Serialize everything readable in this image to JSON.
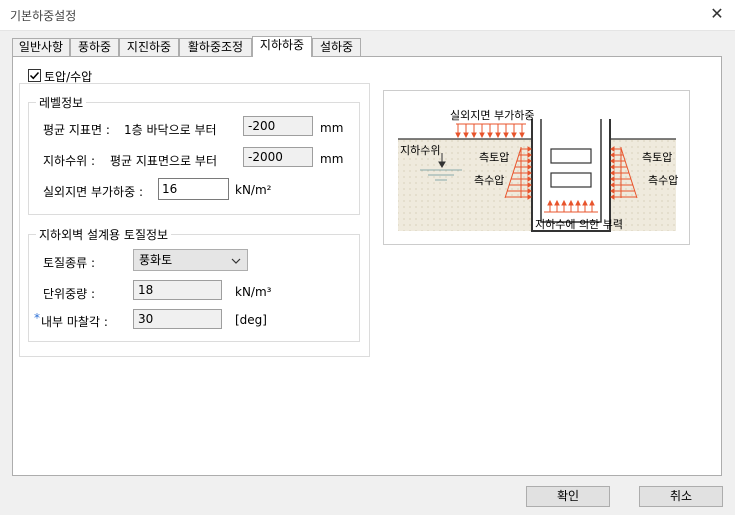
{
  "window": {
    "title": "기본하중설정"
  },
  "tabs": [
    "일반사항",
    "풍하중",
    "지진하중",
    "활하중조정",
    "지하하중",
    "설하중"
  ],
  "active_tab": "지하하중",
  "checkbox": {
    "label": "토압/수압",
    "checked": true
  },
  "level_info": {
    "title": "레벨정보",
    "ground_label": "평균 지표면 :",
    "ground_ref": "1층 바닥으로 부터",
    "ground_value": "-200",
    "ground_unit": "mm",
    "water_label": "지하수위 :",
    "water_ref": "평균 지표면으로 부터",
    "water_value": "-2000",
    "water_unit": "mm",
    "surcharge_label": "실외지면 부가하중 :",
    "surcharge_value": "16",
    "surcharge_unit": "kN/m²"
  },
  "soil_info": {
    "title": "지하외벽 설계용 토질정보",
    "type_label": "토질종류 :",
    "type_value": "풍화토",
    "unit_weight_label": "단위중량 :",
    "unit_weight_value": "18",
    "unit_weight_unit": "kN/m³",
    "friction_marker": "*",
    "friction_label": "내부 마찰각 :",
    "friction_value": "30",
    "friction_unit": "[deg]"
  },
  "diagram": {
    "surcharge": "실외지면 부가하중",
    "water_level": "지하수위",
    "earth_pressure_left": "측토압",
    "water_pressure_left": "측수압",
    "earth_pressure_right": "측토압",
    "water_pressure_right": "측수압",
    "buoyancy": "지하수에 의한 부력",
    "arrow_color": "#e8542c"
  },
  "buttons": {
    "ok": "확인",
    "cancel": "취소"
  }
}
